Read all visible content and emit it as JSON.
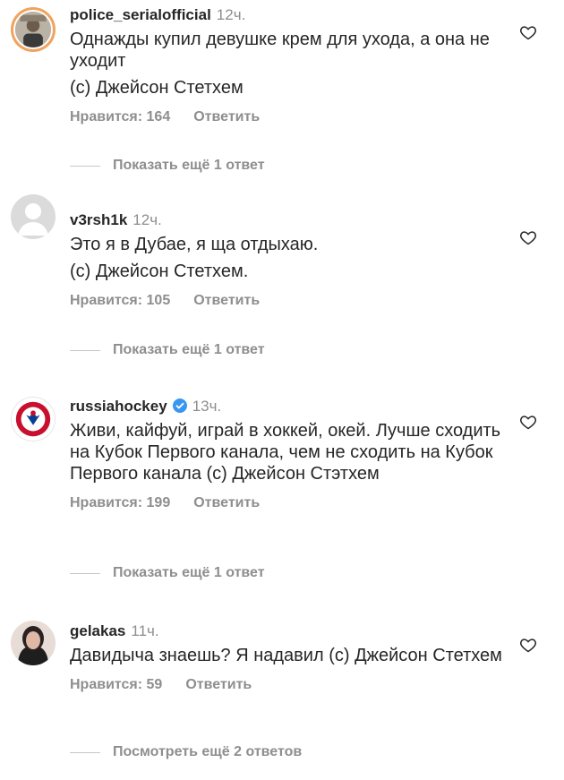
{
  "comments": [
    {
      "username": "police_serialofficial",
      "time": "12ч.",
      "text": [
        "Однажды купил девушке крем для ухода, а она не уходит",
        "(с) Джейсон Стетхем"
      ],
      "likes": "Нравится: 164",
      "reply": "Ответить",
      "more": "Показать ещё 1 ответ",
      "verified": false
    },
    {
      "username": "v3rsh1k",
      "time": "12ч.",
      "text": [
        "Это я в Дубае, я ща отдыхаю.",
        "(с) Джейсон Стетхем."
      ],
      "likes": "Нравится: 105",
      "reply": "Ответить",
      "more": "Показать ещё 1 ответ",
      "verified": false
    },
    {
      "username": "russiahockey",
      "time": "13ч.",
      "text": [
        "Живи, кайфуй, играй в хоккей, окей. Лучше сходить на Кубок Первого канала, чем не сходить на Кубок Первого канала (с) Джейсон Стэтхем"
      ],
      "likes": "Нравится: 199",
      "reply": "Ответить",
      "more": "Показать ещё 1 ответ",
      "verified": true
    },
    {
      "username": "gelakas",
      "time": "11ч.",
      "text": [
        "Давидыча знаешь? Я надавил (с) Джейсон Стетхем"
      ],
      "likes": "Нравится: 59",
      "reply": "Ответить",
      "more": "Посмотреть ещё 2 ответов",
      "verified": false
    }
  ],
  "colors": {
    "text": "#262626",
    "muted": "#8e8e8e",
    "verified": "#3897f0"
  },
  "icons": {
    "like": "heart-outline-icon",
    "verified": "verified-badge-icon"
  }
}
